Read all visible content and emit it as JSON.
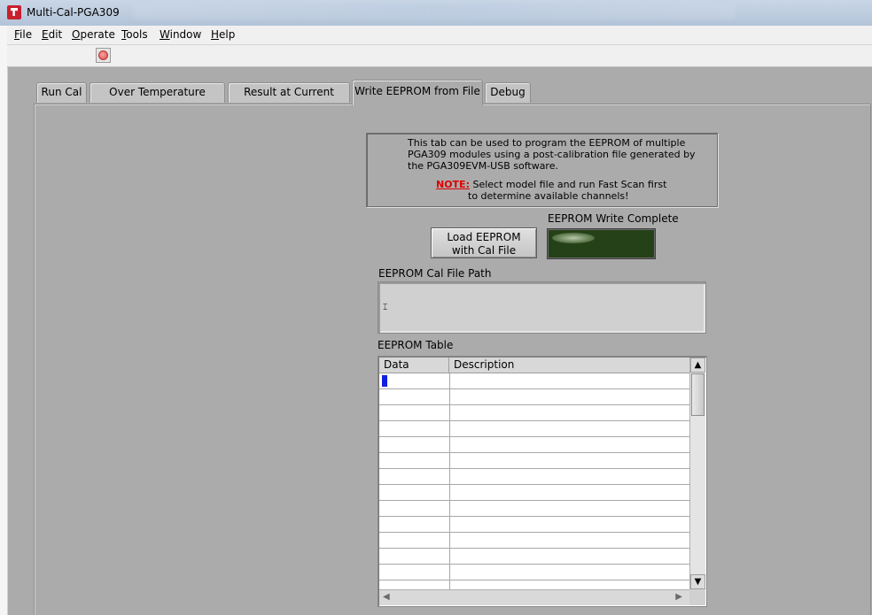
{
  "window": {
    "title": "Multi-Cal-PGA309"
  },
  "menu": [
    {
      "label": "File",
      "u": "F",
      "rest": "ile"
    },
    {
      "label": "Edit",
      "u": "E",
      "rest": "dit"
    },
    {
      "label": "Operate",
      "u": "O",
      "rest": "perate"
    },
    {
      "label": "Tools",
      "u": "T",
      "rest": "ools"
    },
    {
      "label": "Window",
      "u": "W",
      "rest": "indow"
    },
    {
      "label": "Help",
      "u": "H",
      "rest": "elp"
    }
  ],
  "tabs": [
    {
      "label": "Run Cal"
    },
    {
      "label": "Over Temperature Results"
    },
    {
      "label": "Result at Current Temp"
    },
    {
      "label": "Write EEPROM from File",
      "active": true
    },
    {
      "label": "Debug"
    }
  ],
  "info": {
    "line1": "This tab can be used to program the EEPROM of multiple",
    "line2": "PGA309 modules using a post-calibration file generated by",
    "line3": "the PGA309EVM-USB software.",
    "note_label": "NOTE:",
    "note_line1": " Select model file and run Fast Scan first",
    "note_line2": "to determine available channels!"
  },
  "load_button": {
    "line1": "Load EEPROM",
    "line2": "with Cal File"
  },
  "write_complete": {
    "label": "EEPROM Write Complete"
  },
  "path": {
    "label": "EEPROM Cal File Path",
    "value": ""
  },
  "table": {
    "label": "EEPROM Table",
    "columns": [
      "Data",
      "Description"
    ],
    "row_count": 14
  },
  "colors": {
    "background": "#ababab",
    "led_off": "#254118",
    "note": "#e00000"
  }
}
